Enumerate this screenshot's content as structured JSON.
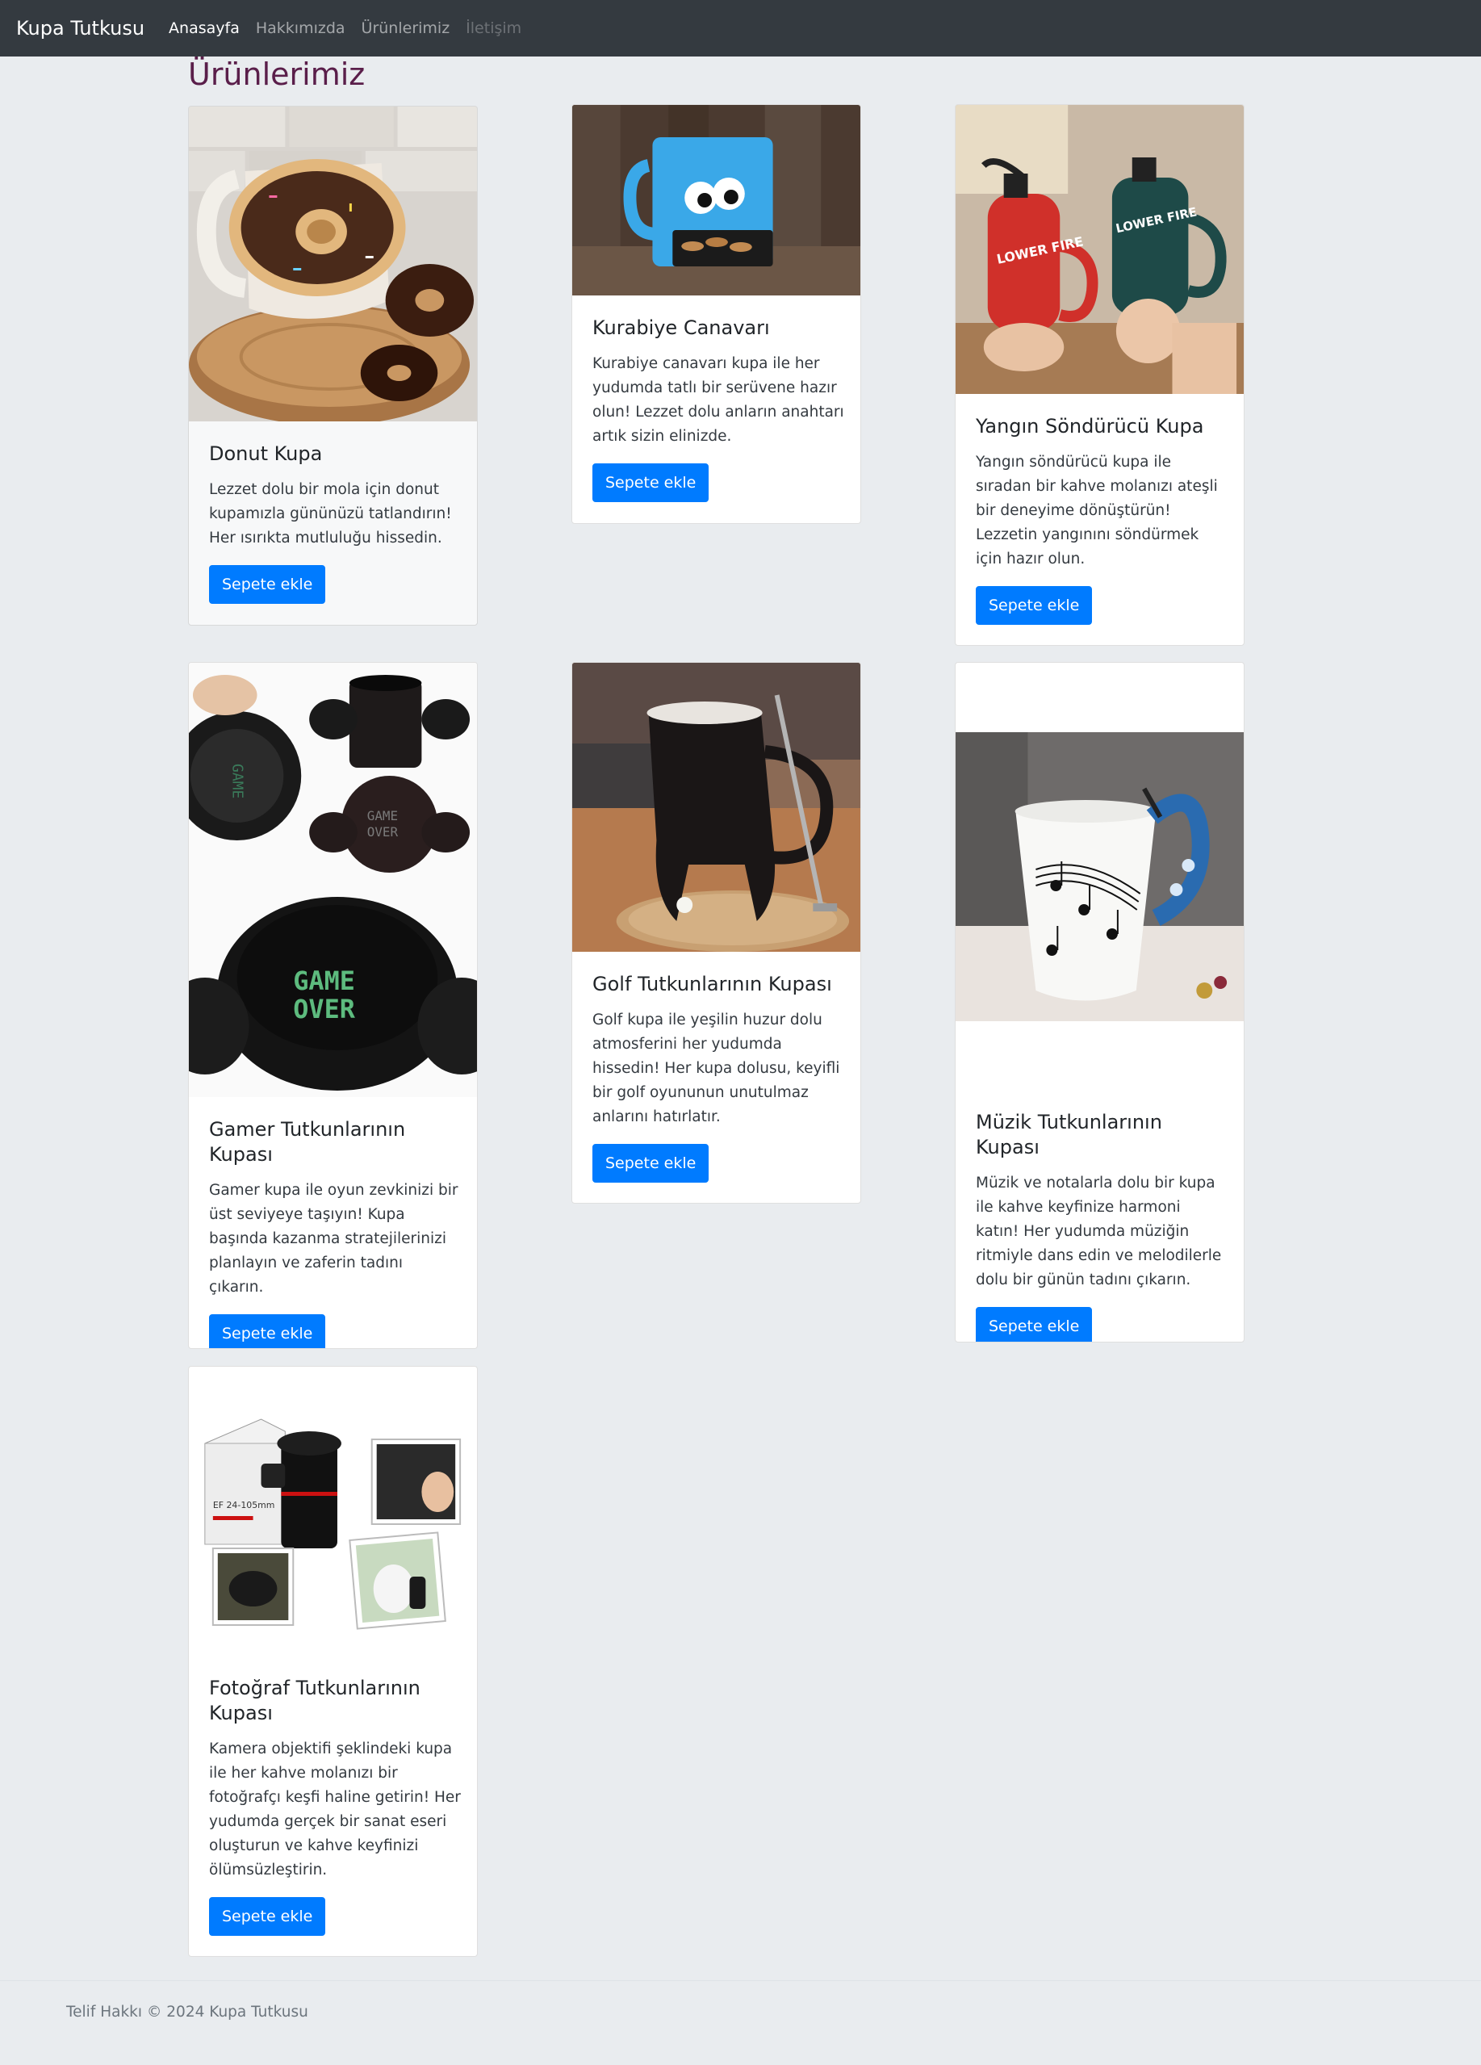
{
  "nav": {
    "brand": "Kupa Tutkusu",
    "links": [
      "Anasayfa",
      "Hakkımızda",
      "Ürünlerimiz",
      "İletişim"
    ]
  },
  "page_title": "Ürünlerimiz",
  "products": [
    {
      "title": "Donut Kupa",
      "text": "Lezzet dolu bir mola için donut kupamızla gününüzü tatlandırın! Her ısırıkta mutluluğu hissedin.",
      "button": "Sepete ekle"
    },
    {
      "title": "Kurabiye Canavarı",
      "text": "Kurabiye canavarı kupa ile her yudumda tatlı bir serüvene hazır olun! Lezzet dolu anların anahtarı artık sizin elinizde.",
      "button": "Sepete ekle"
    },
    {
      "title": "Yangın Söndürücü Kupa",
      "text": "Yangın söndürücü kupa ile sıradan bir kahve molanızı ateşli bir deneyime dönüştürün! Lezzetin yangınını söndürmek için hazır olun.",
      "button": "Sepete ekle"
    },
    {
      "title": "Gamer Tutkunlarının Kupası",
      "text": "Gamer kupa ile oyun zevkinizi bir üst seviyeye taşıyın! Kupa başında kazanma stratejilerinizi planlayın ve zaferin tadını çıkarın.",
      "button": "Sepete ekle"
    },
    {
      "title": "Golf Tutkunlarının Kupası",
      "text": "Golf kupa ile yeşilin huzur dolu atmosferini her yudumda hissedin! Her kupa dolusu, keyifli bir golf oyununun unutulmaz anlarını hatırlatır.",
      "button": "Sepete ekle"
    },
    {
      "title": "Müzik Tutkunlarının Kupası",
      "text": "Müzik ve notalarla dolu bir kupa ile kahve keyfinize harmoni katın! Her yudumda müziğin ritmiyle dans edin ve melodilerle dolu bir günün tadını çıkarın.",
      "button": "Sepete ekle"
    },
    {
      "title": "Fotoğraf Tutkunlarının Kupası",
      "text": "Kamera objektifi şeklindeki kupa ile her kahve molanızı bir fotoğrafçı keşfi haline getirin! Her yudumda gerçek bir sanat eseri oluşturun ve kahve keyfinizi ölümsüzleştirin.",
      "button": "Sepete ekle"
    }
  ],
  "images": {
    "text_on_images": [
      "LOWER FIRE",
      "LOWER FIRE",
      "GAME OVER",
      "GAME OVER",
      "GAME OVER",
      "EF 24-105mm"
    ]
  },
  "colors": {
    "navbar": "#343a40",
    "primary": "#007bff",
    "title": "#5a1e4a",
    "page_bg": "#e9ecef"
  },
  "footer": {
    "text": "Telif Hakkı © 2024 Kupa Tutkusu"
  }
}
